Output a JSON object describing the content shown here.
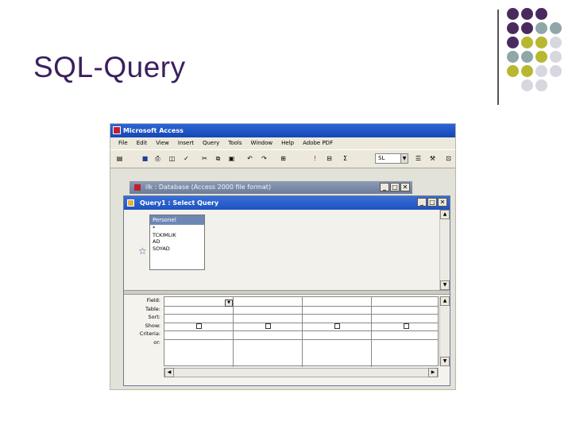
{
  "slide": {
    "title": "SQL-Query"
  },
  "decoration": {
    "dots": [
      [
        "#4a2a5e",
        "#4a2a5e",
        "#4a2a5e",
        ""
      ],
      [
        "#4a2a5e",
        "#4a2a5e",
        "#8fa7a6",
        "#8fa7a6"
      ],
      [
        "#4a2a5e",
        "#b7b731",
        "#b7b731",
        "#d7d7e0"
      ],
      [
        "#8fa7a6",
        "#8fa7a6",
        "#b7b731",
        "#d7d7e0"
      ],
      [
        "#b7b731",
        "#b7b731",
        "#d7d7e0",
        "#d7d7e0"
      ],
      [
        "",
        "#d7d7e0",
        "#d7d7e0",
        ""
      ]
    ]
  },
  "app": {
    "title": "Microsoft Access",
    "menu": [
      "File",
      "Edit",
      "View",
      "Insert",
      "Query",
      "Tools",
      "Window",
      "Help",
      "Adobe PDF"
    ],
    "toolbar_combo_value": "SL"
  },
  "database_window": {
    "title": "ilk : Database (Access 2000 file format)"
  },
  "query_window": {
    "title": "Query1 : Select Query",
    "table": {
      "name": "Personel",
      "fields": [
        "*",
        "TCKIMLIK",
        "AD",
        "SOYAD"
      ]
    },
    "grid_rows": [
      "Field:",
      "Table:",
      "Sort:",
      "Show:",
      "Criteria:",
      "or:"
    ]
  },
  "window_buttons": {
    "minimize": "_",
    "maximize": "□",
    "close": "✕"
  }
}
